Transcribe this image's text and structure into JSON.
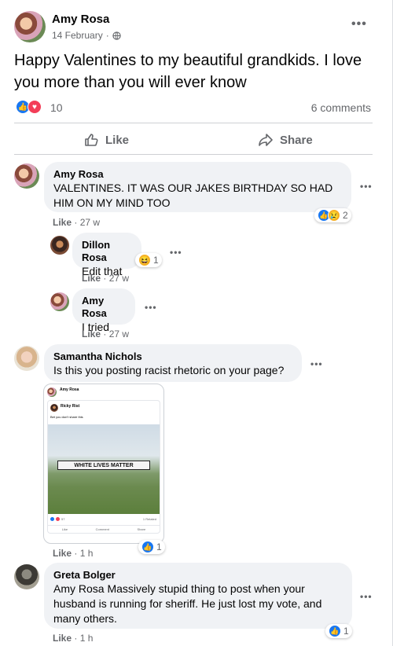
{
  "post": {
    "author": "Amy Rosa",
    "date": "14 February",
    "audience_sep": "·",
    "text": "Happy Valentines to my beautiful grandkids. I love you more than you will ever know",
    "reaction_count": "10",
    "comments_count": "6 comments",
    "like_label": "Like",
    "share_label": "Share"
  },
  "comments": [
    {
      "author": "Amy Rosa",
      "text": "VALENTINES. IT WAS OUR JAKES BIRTHDAY SO HAD HIM ON MY MIND TOO",
      "like": "Like",
      "time": "27 w",
      "reactions": "2"
    },
    {
      "author": "Dillon Rosa",
      "text": "Edit that",
      "like": "Like",
      "time": "27 w",
      "reactions": "1"
    },
    {
      "author": "Amy Rosa",
      "text": "I tried",
      "like": "Like",
      "time": "27 w"
    },
    {
      "author": "Samantha Nichols",
      "text": "Is this you posting racist rhetoric on your page?",
      "like": "Like",
      "time": "1 h",
      "reactions": "1"
    },
    {
      "author": "Greta Bolger",
      "text": "Amy Rosa Massively stupid thing to post when your husband is running for sheriff. He just lost my vote, and many others.",
      "like": "Like",
      "time": "1 h",
      "reactions": "1"
    }
  ],
  "screenshot": {
    "author": "Amy Rosa",
    "inner_author": "Ricky Rist",
    "inner_text": "Bet you don't share this",
    "banner": "WHITE LIVES MATTER",
    "count": "57",
    "shared": "1 Related",
    "like": "Like",
    "comment": "Comment",
    "share": "Share"
  },
  "colors": {
    "accent": "#1877f2",
    "love": "#f33e58",
    "bubble": "#f0f2f5",
    "muted": "#65676b"
  }
}
